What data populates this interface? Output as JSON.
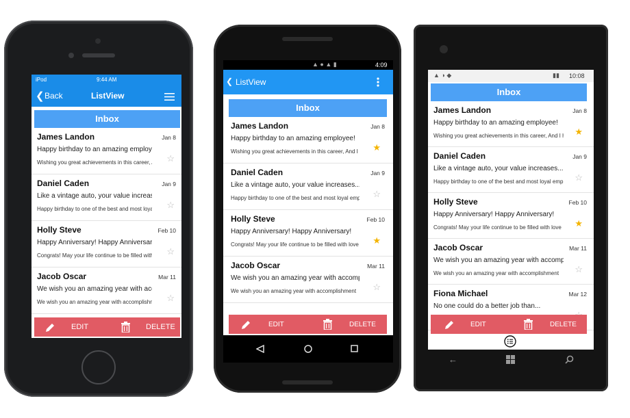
{
  "colors": {
    "ios_header": "#1a8ce8",
    "android_header": "#2196f3",
    "inbox_bg": "#4da1f5",
    "action_bg": "#e15b64",
    "star_on": "#f4b400",
    "star_off": "#b8b8b8"
  },
  "ios": {
    "status": {
      "carrier": "iPod",
      "time": "9:44 AM"
    },
    "nav": {
      "back": "Back",
      "title": "ListView"
    },
    "inbox": "Inbox",
    "items": [
      {
        "name": "James Landon",
        "date": "Jan 8",
        "subject": "Happy birthday to an amazing employee!",
        "body": "Wishing you great achievements in this career, And I hope",
        "starred": false
      },
      {
        "name": "Daniel Caden",
        "date": "Jan 9",
        "subject": "Like a vintage auto, your value increases...",
        "body": "Happy birthday to one of the best and most loyal employees",
        "starred": false
      },
      {
        "name": "Holly Steve",
        "date": "Feb 10",
        "subject": "Happy Anniversary! Happy Anniversary!",
        "body": "Congrats! May your life continue to be filled with love",
        "starred": false
      },
      {
        "name": "Jacob Oscar",
        "date": "Mar 11",
        "subject": "We wish you an amazing year with accomplishment",
        "body": "We wish you an amazing year with accomplishment",
        "starred": false
      }
    ],
    "actions": {
      "edit": "EDIT",
      "delete": "DELETE"
    }
  },
  "android": {
    "status": {
      "time": "4:09"
    },
    "nav": {
      "title": "ListView"
    },
    "inbox": "Inbox",
    "items": [
      {
        "name": "James Landon",
        "date": "Jan 8",
        "subject": "Happy birthday to an amazing employee!",
        "body": "Wishing you great achievements in this career, And I hope",
        "starred": true
      },
      {
        "name": "Daniel Caden",
        "date": "Jan 9",
        "subject": "Like a vintage auto, your value increases...",
        "body": "Happy birthday to one of the best and most loyal employees",
        "starred": false
      },
      {
        "name": "Holly Steve",
        "date": "Feb 10",
        "subject": "Happy Anniversary! Happy Anniversary!",
        "body": "Congrats! May your life continue to be filled with love",
        "starred": true
      },
      {
        "name": "Jacob Oscar",
        "date": "Mar 11",
        "subject": "We wish you an amazing year with accomplishment",
        "body": "We wish you an amazing year with accomplishment",
        "starred": false
      }
    ],
    "actions": {
      "edit": "EDIT",
      "delete": "DELETE"
    }
  },
  "windows": {
    "status": {
      "time": "10:08"
    },
    "inbox": "Inbox",
    "items": [
      {
        "name": "James Landon",
        "date": "Jan 8",
        "subject": "Happy birthday to an amazing employee!",
        "body": "Wishing you great achievements in this career, And I hope",
        "starred": true
      },
      {
        "name": "Daniel Caden",
        "date": "Jan 9",
        "subject": "Like a vintage auto, your value increases...",
        "body": "Happy birthday to one of the best and most loyal employees",
        "starred": false
      },
      {
        "name": "Holly Steve",
        "date": "Feb 10",
        "subject": "Happy Anniversary! Happy Anniversary!",
        "body": "Congrats! May your life continue to be filled with love",
        "starred": true
      },
      {
        "name": "Jacob Oscar",
        "date": "Mar 11",
        "subject": "We wish you an amazing year with accomplishment",
        "body": "We wish you an amazing year with accomplishment",
        "starred": false
      },
      {
        "name": "Fiona Michael",
        "date": "Mar 12",
        "subject": "No one could do a better job than...",
        "body": "",
        "starred": false
      }
    ],
    "actions": {
      "edit": "EDIT",
      "delete": "DELETE"
    }
  },
  "icons": {
    "edit": "pencil-icon",
    "delete": "trash-icon",
    "star": "star-icon",
    "back": "chevron-left-icon",
    "menu": "hamburger-menu-icon",
    "overflow": "more-vert-icon"
  }
}
